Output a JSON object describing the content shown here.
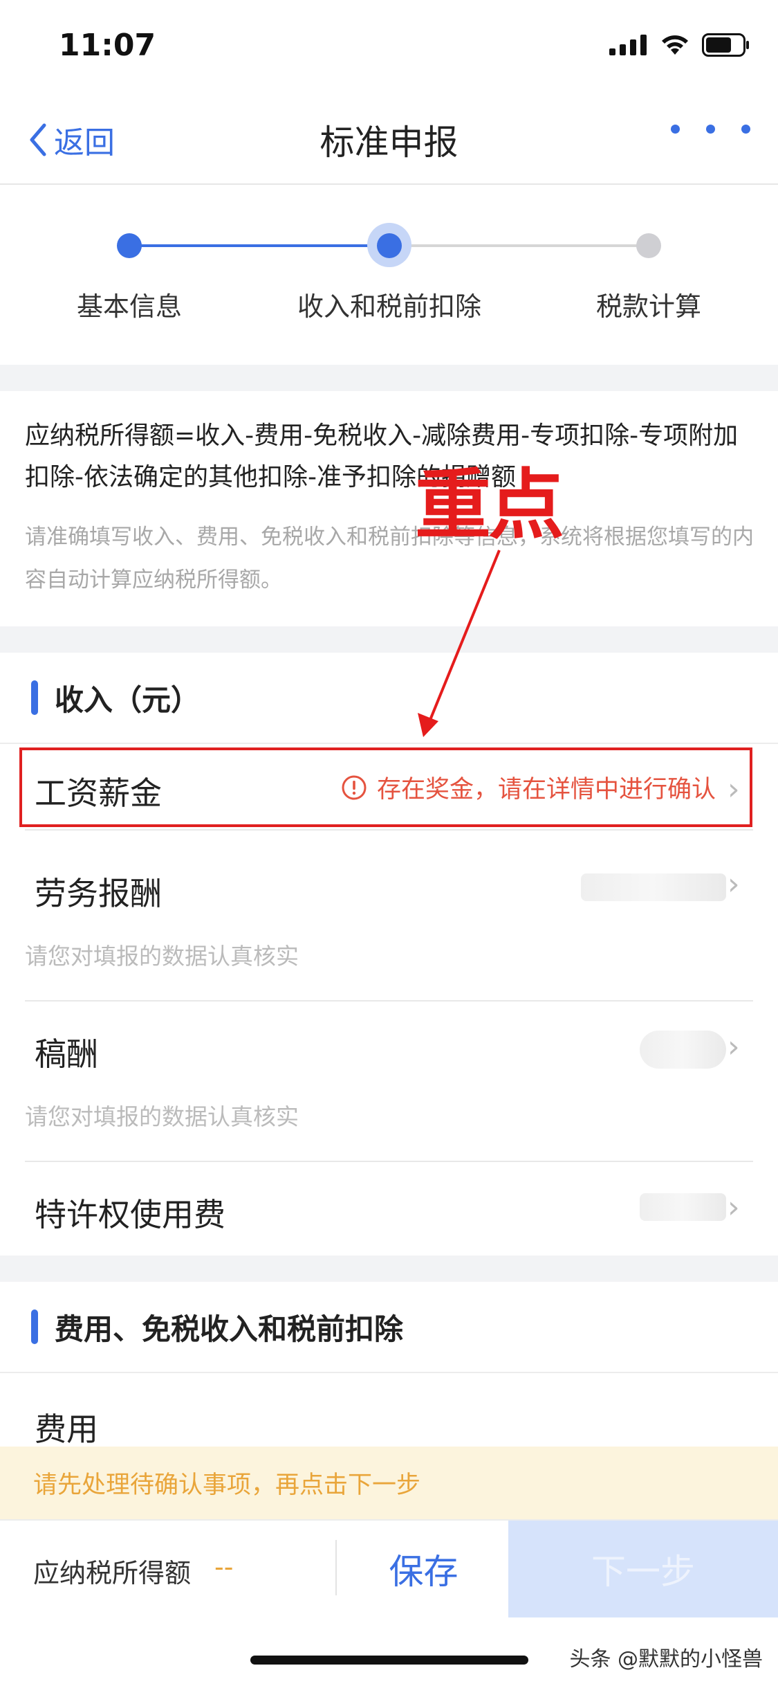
{
  "status": {
    "time": "11:07"
  },
  "nav": {
    "back_label": "返回",
    "title": "标准申报"
  },
  "stepper": {
    "steps": [
      {
        "label": "基本信息",
        "state": "done"
      },
      {
        "label": "收入和税前扣除",
        "state": "current"
      },
      {
        "label": "税款计算",
        "state": "pending"
      }
    ]
  },
  "formula": {
    "text": "应纳税所得额=收入-费用-免税收入-减除费用-专项扣除-专项附加扣除-依法确定的其他扣除-准予扣除的捐赠额",
    "note": "请准确填写收入、费用、免税收入和税前扣除等信息，系统将根据您填写的内容自动计算应纳税所得额。"
  },
  "annotation": {
    "text": "重点"
  },
  "income_section": {
    "title": "收入（元）",
    "rows": [
      {
        "label": "工资薪金",
        "warning": "存在奖金，请在详情中进行确认"
      },
      {
        "label": "劳务报酬",
        "sub": "请您对填报的数据认真核实"
      },
      {
        "label": "稿酬",
        "sub": "请您对填报的数据认真核实"
      },
      {
        "label": "特许权使用费"
      }
    ]
  },
  "deduction_section": {
    "title": "费用、免税收入和税前扣除",
    "rows": [
      {
        "label": "费用"
      }
    ]
  },
  "notice": {
    "text": "请先处理待确认事项，再点击下一步"
  },
  "bottom": {
    "taxable_label": "应纳税所得额",
    "taxable_value": "--",
    "save_label": "保存",
    "next_label": "下一步"
  },
  "watermark": "头条 @默默的小怪兽",
  "colors": {
    "accent": "#3a6fe3",
    "warning": "#e5533f",
    "notice_bg": "#fcf4dd",
    "notice_text": "#e9a53a"
  }
}
